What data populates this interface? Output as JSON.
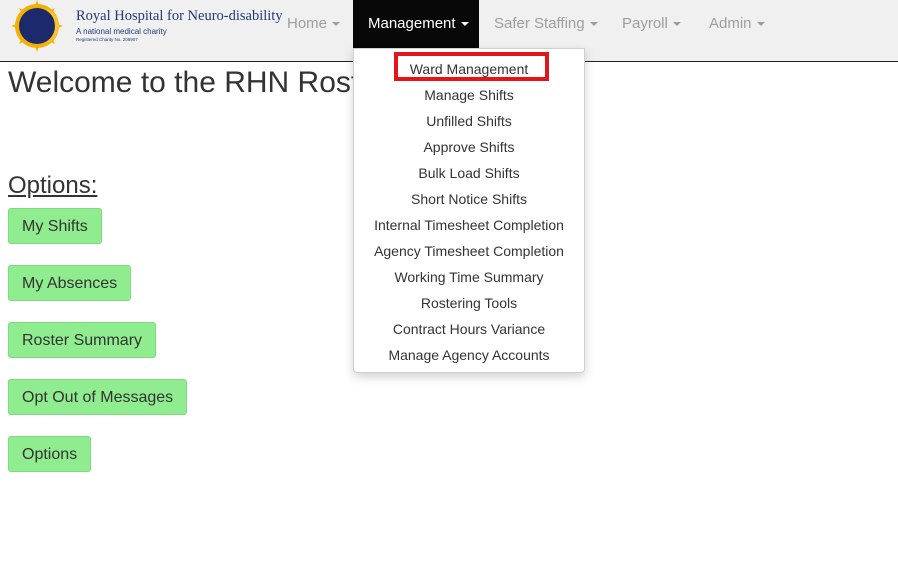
{
  "brand": {
    "title": "Royal Hospital for Neuro-disability",
    "subtitle": "A national medical charity",
    "registered": "Registered Charity No. 205907",
    "logo_icon": "sun-logo-icon",
    "colors": {
      "navy": "#1e3a78",
      "sun": "#f4b000"
    }
  },
  "nav": {
    "items": [
      {
        "label": "Home"
      },
      {
        "label": "Management"
      },
      {
        "label": "Safer Staffing"
      },
      {
        "label": "Payroll"
      },
      {
        "label": "Admin"
      }
    ],
    "active": "Management"
  },
  "dropdown": {
    "items": [
      "Ward Management",
      "Manage Shifts",
      "Unfilled Shifts",
      "Approve Shifts",
      "Bulk Load Shifts",
      "Short Notice Shifts",
      "Internal Timesheet Completion",
      "Agency Timesheet Completion",
      "Working Time Summary",
      "Rostering Tools",
      "Contract Hours Variance",
      "Manage Agency Accounts"
    ],
    "highlighted": "Ward Management",
    "highlight_color": "#e3151b"
  },
  "main": {
    "welcome": "Welcome to the RHN Roster",
    "options_heading": "Options:",
    "buttons": [
      "My Shifts",
      "My Absences",
      "Roster Summary",
      "Opt Out of Messages",
      "Options"
    ],
    "button_color": "#8fec8f"
  }
}
